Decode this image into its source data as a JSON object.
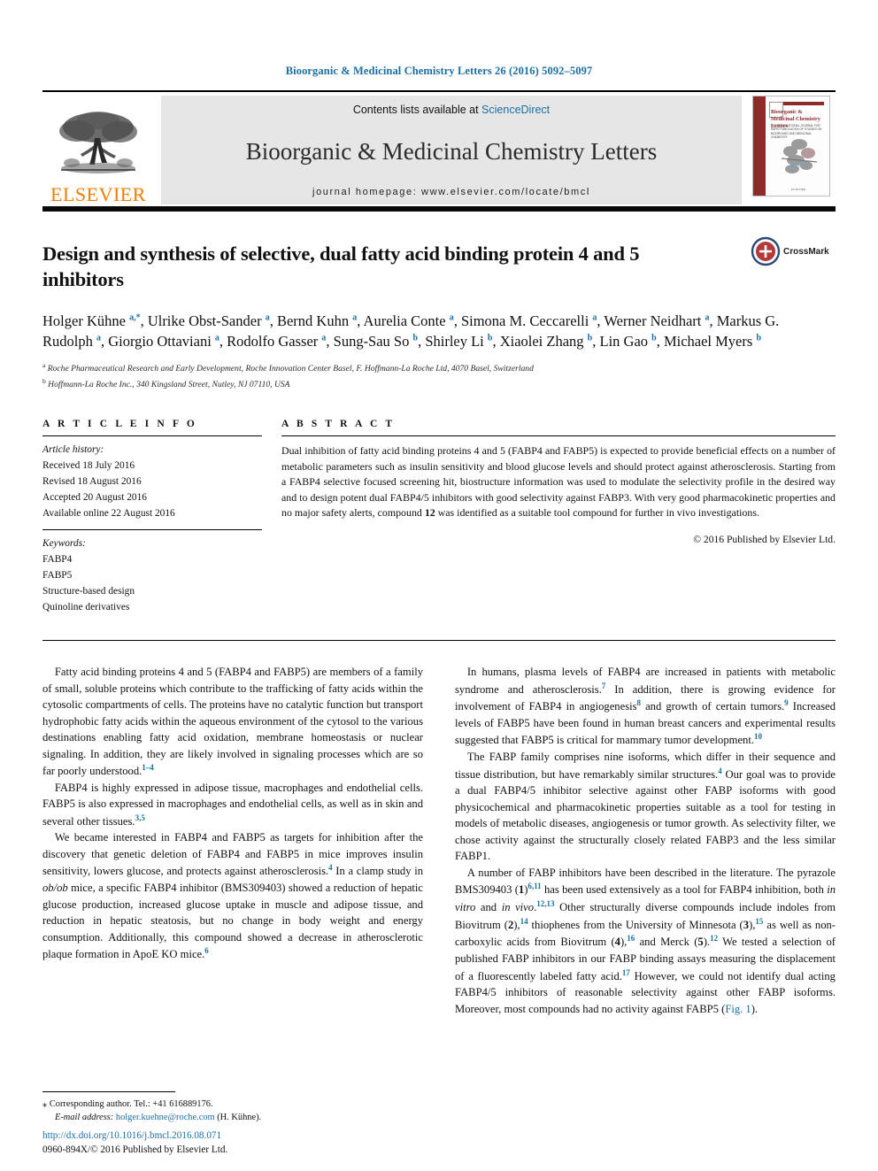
{
  "running_head": "Bioorganic & Medicinal Chemistry Letters 26 (2016) 5092–5097",
  "masthead": {
    "publisher_wordmark": "ELSEVIER",
    "contents_prefix": "Contents lists available at ",
    "contents_link": "ScienceDirect",
    "journal_name": "Bioorganic & Medicinal Chemistry Letters",
    "homepage": "journal homepage: www.elsevier.com/locate/bmcl",
    "cover": {
      "title": "Bioorganic & Medicinal Chemistry Letters",
      "subtitle": "THE INTERNATIONAL JOURNAL FOR RAPID PUBLICATION OF STUDIES ON BIOORGANIC AND MEDICINAL CHEMISTRY",
      "footer": "ELSEVIER"
    }
  },
  "article": {
    "title": "Design and synthesis of selective, dual fatty acid binding protein 4 and 5 inhibitors",
    "crossmark_label": "CrossMark",
    "authors_html": "Holger Kühne <sup>a,*</sup>, Ulrike Obst-Sander <sup>a</sup>, Bernd Kuhn <sup>a</sup>, Aurelia Conte <sup>a</sup>, Simona M. Ceccarelli <sup>a</sup>, Werner Neidhart <sup>a</sup>, Markus G. Rudolph <sup>a</sup>, Giorgio Ottaviani <sup>a</sup>, Rodolfo Gasser <sup>a</sup>, Sung-Sau So <sup>b</sup>, Shirley Li <sup>b</sup>, Xiaolei Zhang <sup>b</sup>, Lin Gao <sup>b</sup>, Michael Myers <sup>b</sup>",
    "affiliation_a": "Roche Pharmaceutical Research and Early Development, Roche Innovation Center Basel, F. Hoffmann-La Roche Ltd, 4070 Basel, Switzerland",
    "affiliation_b": "Hoffmann-La Roche Inc., 340 Kingsland Street, Nutley, NJ 07110, USA"
  },
  "article_info": {
    "heading": "A R T I C L E   I N F O",
    "history_label": "Article history:",
    "history": [
      "Received 18 July 2016",
      "Revised 18 August 2016",
      "Accepted 20 August 2016",
      "Available online 22 August 2016"
    ],
    "keywords_label": "Keywords:",
    "keywords": [
      "FABP4",
      "FABP5",
      "Structure-based design",
      "Quinoline derivatives"
    ]
  },
  "abstract": {
    "heading": "A B S T R A C T",
    "text_html": "Dual inhibition of fatty acid binding proteins 4 and 5 (FABP4 and FABP5) is expected to provide beneficial effects on a number of metabolic parameters such as insulin sensitivity and blood glucose levels and should protect against atherosclerosis. Starting from a FABP4 selective focused screening hit, biostructure information was used to modulate the selectivity profile in the desired way and to design potent dual FABP4/5 inhibitors with good selectivity against FABP3. With very good pharmacokinetic properties and no major safety alerts, compound <b>12</b> was identified as a suitable tool compound for further in vivo investigations.",
    "copyright": "© 2016 Published by Elsevier Ltd."
  },
  "body": {
    "left_column_html": "<p class=\"first\">Fatty acid binding proteins 4 and 5 (FABP4 and FABP5) are members of a family of small, soluble proteins which contribute to the trafficking of fatty acids within the cytosolic compartments of cells. The proteins have no catalytic function but transport hydrophobic fatty acids within the aqueous environment of the cytosol to the various destinations enabling fatty acid oxidation, membrane homeostasis or nuclear signaling. In addition, they are likely involved in signaling processes which are so far poorly understood.<sup>1&ndash;4</sup></p><p>FABP4 is highly expressed in adipose tissue, macrophages and endothelial cells. FABP5 is also expressed in macrophages and endothelial cells, as well as in skin and several other tissues.<sup>3,5</sup></p><p>We became interested in FABP4 and FABP5 as targets for inhibition after the discovery that genetic deletion of FABP4 and FABP5 in mice improves insulin sensitivity, lowers glucose, and protects against atherosclerosis.<sup>4</sup> In a clamp study in <i>ob/ob</i> mice, a specific FABP4 inhibitor (BMS309403) showed a reduction of hepatic glucose production, increased glucose uptake in muscle and adipose tissue, and reduction in hepatic steatosis, but no change in body weight and energy consumption. Additionally, this compound showed a decrease in atherosclerotic plaque formation in ApoE KO mice.<sup>6</sup></p>",
    "right_column_html": "<p class=\"first\">In humans, plasma levels of FABP4 are increased in patients with metabolic syndrome and atherosclerosis.<sup>7</sup> In addition, there is growing evidence for involvement of FABP4 in angiogenesis<sup>8</sup> and growth of certain tumors.<sup>9</sup> Increased levels of FABP5 have been found in human breast cancers and experimental results suggested that FABP5 is critical for mammary tumor development.<sup>10</sup></p><p>The FABP family comprises nine isoforms, which differ in their sequence and tissue distribution, but have remarkably similar structures.<sup>4</sup> Our goal was to provide a dual FABP4/5 inhibitor selective against other FABP isoforms with good physicochemical and pharmacokinetic properties suitable as a tool for testing in models of metabolic diseases, angiogenesis or tumor growth. As selectivity filter, we chose activity against the structurally closely related FABP3 and the less similar FABP1.</p><p>A number of FABP inhibitors have been described in the literature. The pyrazole BMS309403 (<b>1</b>)<sup>6,11</sup> has been used extensively as a tool for FABP4 inhibition, both <i>in vitro</i> and <i>in vivo</i>.<sup>12,13</sup> Other structurally diverse compounds include indoles from Biovitrum (<b>2</b>),<sup>14</sup> thiophenes from the University of Minnesota (<b>3</b>),<sup>15</sup> as well as non-carboxylic acids from Biovitrum (<b>4</b>),<sup>16</sup> and Merck (<b>5</b>).<sup>12</sup> We tested a selection of published FABP inhibitors in our FABP binding assays measuring the displacement of a fluorescently labeled fatty acid.<sup>17</sup> However, we could not identify dual acting FABP4/5 inhibitors of reasonable selectivity against other FABP isoforms. Moreover, most compounds had no activity against FABP5 (<span class=\"lnk\">Fig. 1</span>)."
  },
  "footnote": {
    "corresponding_marker": "⁎",
    "corresponding_text": "Corresponding author. Tel.: +41 616889176.",
    "email_label": "E-mail address:",
    "email": "holger.kuehne@roche.com",
    "email_owner": "(H. Kühne)."
  },
  "footer": {
    "doi": "http://dx.doi.org/10.1016/j.bmcl.2016.08.071",
    "issn_line": "0960-894X/© 2016 Published by Elsevier Ltd."
  },
  "colors": {
    "link_blue": "#1a6fa3",
    "elsevier_orange": "#F07C00",
    "cover_red": "#8e2a2a",
    "band_grey": "#e6e6e6"
  }
}
